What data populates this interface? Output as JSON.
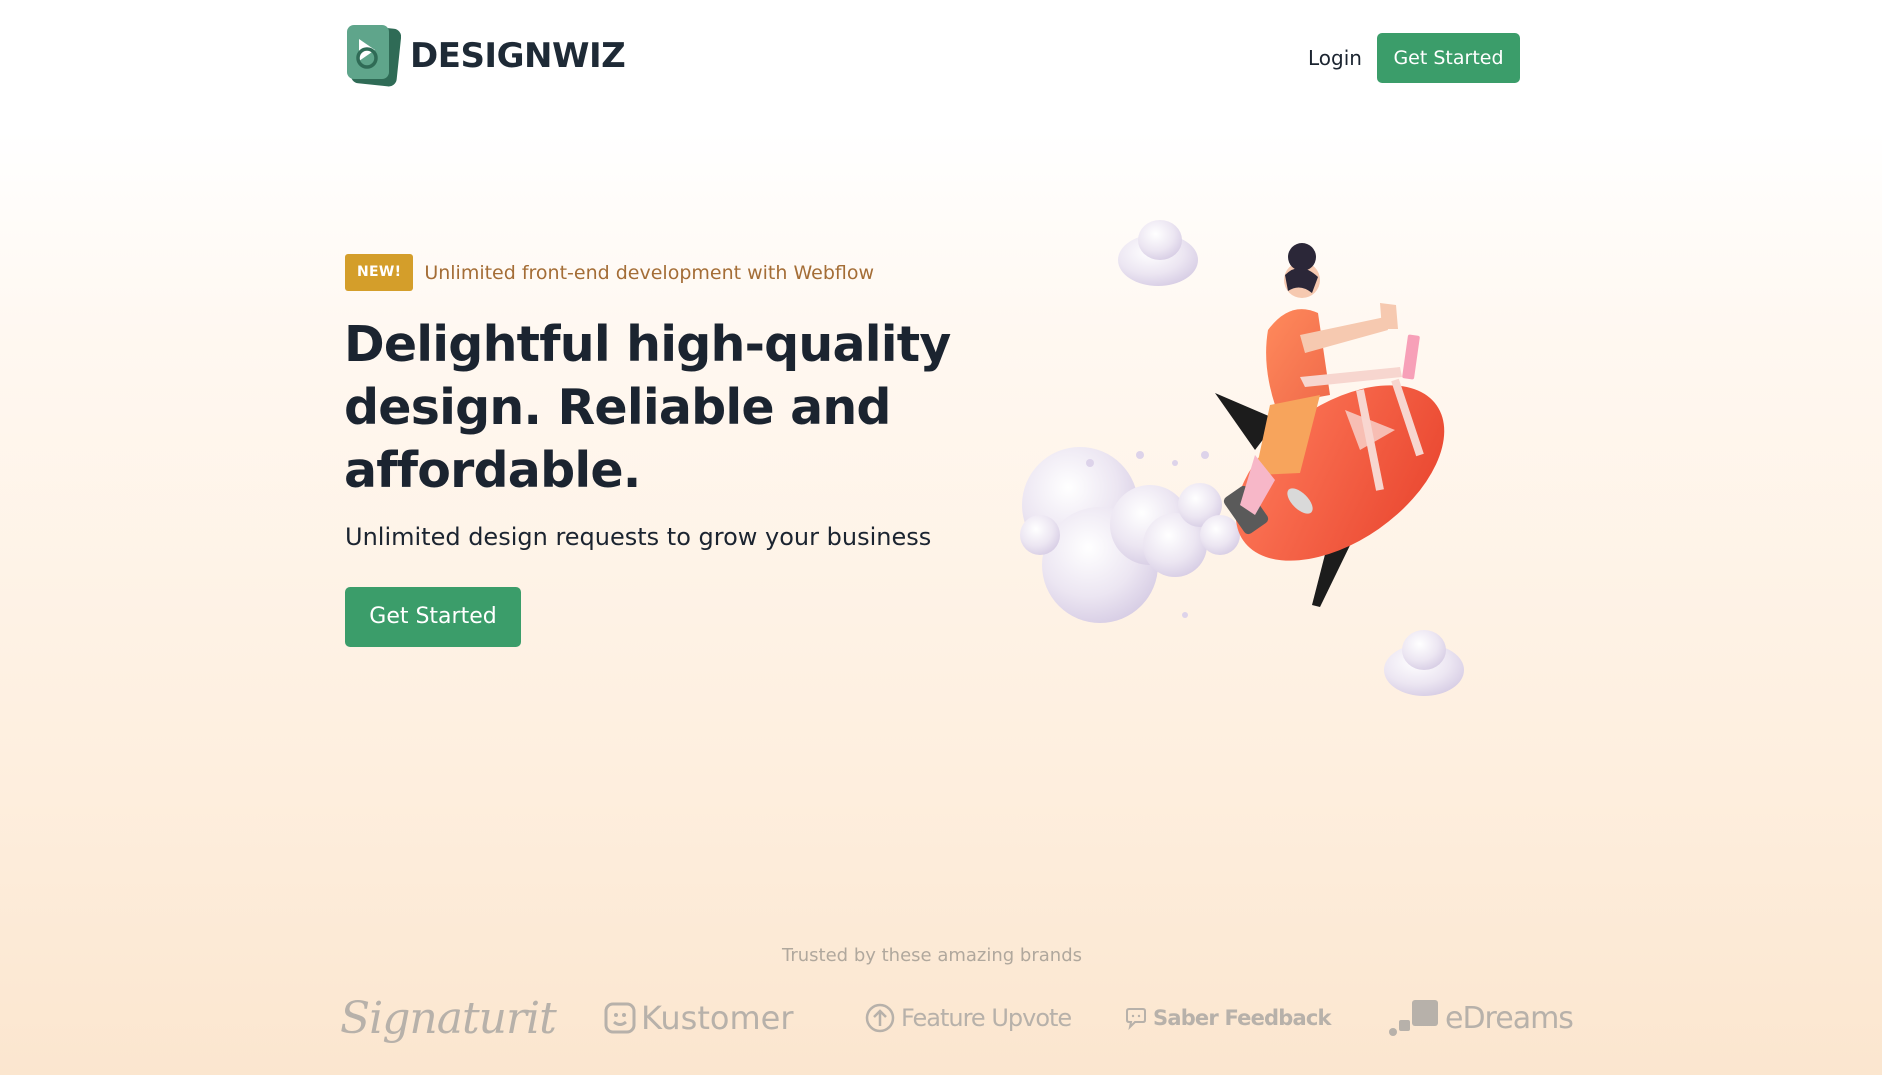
{
  "header": {
    "logo_text": "DESIGNWIZ",
    "login_label": "Login",
    "cta_label": "Get Started"
  },
  "hero": {
    "badge": "NEW!",
    "announcement": "Unlimited front-end development with Webflow",
    "title": "Delightful high-quality design. Reliable and affordable.",
    "subtitle": "Unlimited design requests to grow your business",
    "cta_label": "Get Started"
  },
  "brands": {
    "heading": "Trusted by these amazing brands",
    "items": [
      {
        "name": "Signaturit",
        "icon": "signature-script"
      },
      {
        "name": "Kustomer",
        "icon": "smiley-square-icon"
      },
      {
        "name": "Feature Upvote",
        "icon": "arrow-up-circle-icon"
      },
      {
        "name": "Saber Feedback",
        "icon": "speech-bubble-icon"
      },
      {
        "name": "eDreams",
        "icon": "dots-squares-icon"
      }
    ]
  },
  "colors": {
    "accent_green": "#3b9d6a",
    "badge_gold": "#d49e2a",
    "announcement_text": "#a46d36",
    "heading_dark": "#1b2430",
    "brand_gray": "#b7b1aa"
  }
}
